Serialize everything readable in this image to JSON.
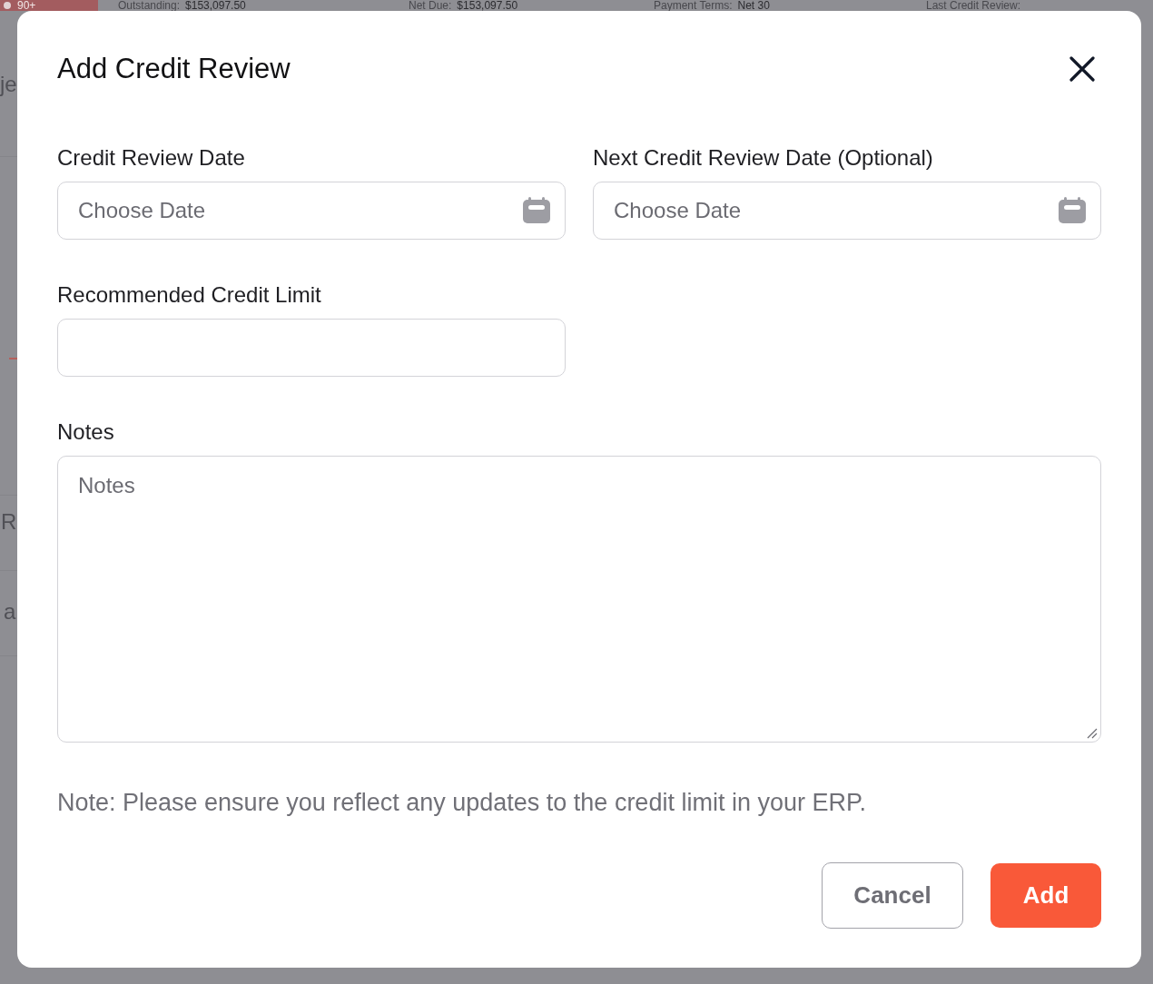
{
  "background": {
    "badge": "90+",
    "summary": [
      {
        "label": "Outstanding:",
        "value": "$153,097.50"
      },
      {
        "label": "Net Due:",
        "value": "$153,097.50"
      },
      {
        "label": "Payment Terms:",
        "value": "Net 30"
      },
      {
        "label": "Last Credit Review:"
      }
    ],
    "fragments": [
      "je",
      "R",
      "a"
    ]
  },
  "dialog": {
    "title": "Add Credit Review",
    "fields": [
      {
        "kind": "date",
        "label": "Credit Review Date",
        "placeholder": "Choose Date"
      },
      {
        "kind": "date",
        "label": "Next Credit Review Date (Optional)",
        "placeholder": "Choose Date"
      },
      {
        "kind": "text",
        "label": "Recommended Credit Limit"
      },
      {
        "kind": "textarea",
        "label": "Notes",
        "placeholder": "Notes"
      }
    ],
    "note": "Note: Please ensure you reflect any updates to the credit limit in your ERP.",
    "buttons": [
      {
        "kind": "secondary",
        "label": "Cancel"
      },
      {
        "kind": "primary",
        "label": "Add"
      }
    ]
  }
}
